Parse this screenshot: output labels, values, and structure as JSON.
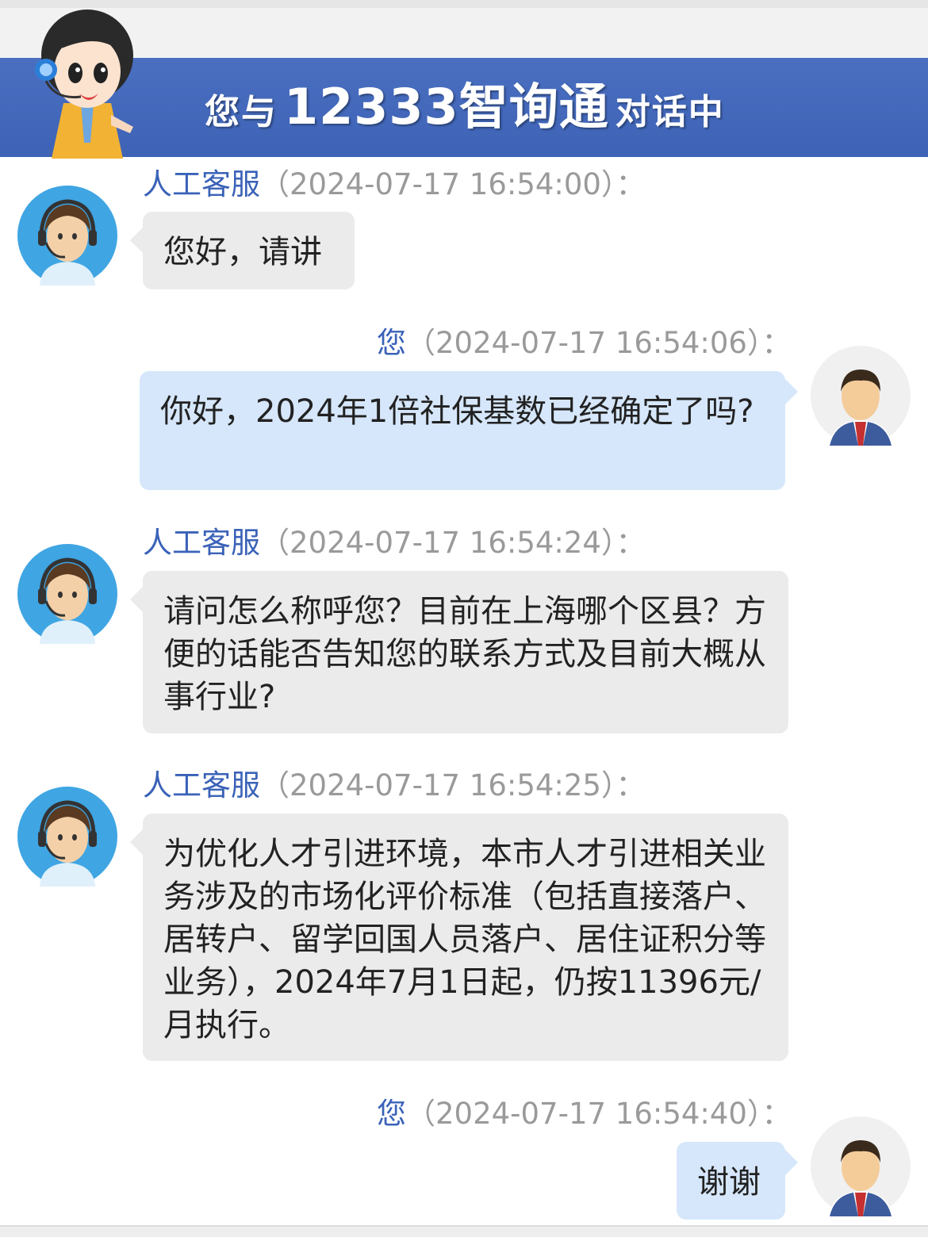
{
  "header": {
    "title_prefix": "您与",
    "title_brand": "12333智询通",
    "title_suffix": "对话中"
  },
  "messages": [
    {
      "sender": "人工客服",
      "time": "（2024-07-17 16:54:00）：",
      "text": "您好，请讲"
    },
    {
      "sender": "您",
      "time": "（2024-07-17 16:54:06）：",
      "text": "你好，2024年1倍社保基数已经确定了吗?"
    },
    {
      "sender": "人工客服",
      "time": "（2024-07-17 16:54:24）：",
      "text": "请问怎么称呼您？目前在上海哪个区县？方便的话能否告知您的联系方式及目前大概从事行业?"
    },
    {
      "sender": "人工客服",
      "time": "（2024-07-17 16:54:25）：",
      "text": "为优化人才引进环境，本市人才引进相关业务涉及的市场化评价标准（包括直接落户、居转户、留学回国人员落户、居住证积分等业务），2024年7月1日起，仍按11396元/月执行。"
    },
    {
      "sender": "您",
      "time": "（2024-07-17 16:54:40）：",
      "text": "谢谢"
    }
  ],
  "colors": {
    "banner": "#3e63b6",
    "agent_bubble": "#ebebeb",
    "user_bubble": "#d6e7fb",
    "sender_name": "#3a62b8",
    "timestamp": "#9a9a9a"
  },
  "icons": {
    "mascot": "customer-service-mascot-icon",
    "agent_avatar": "agent-headset-avatar-icon",
    "user_avatar": "user-avatar-icon"
  }
}
